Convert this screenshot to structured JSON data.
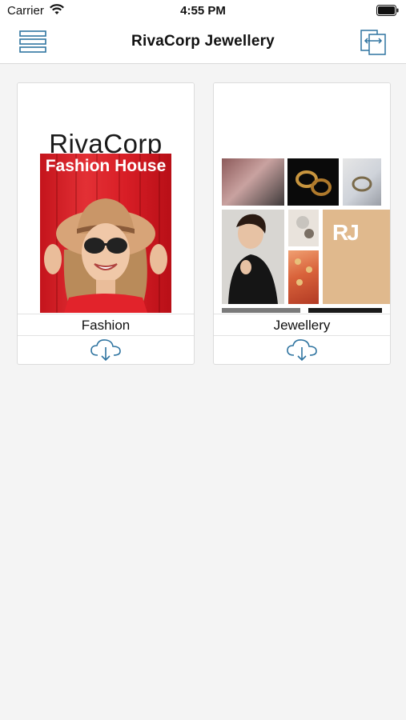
{
  "status_bar": {
    "carrier": "Carrier",
    "time": "4:55 PM"
  },
  "nav": {
    "title": "RivaCorp Jewellery",
    "menu_icon": "hamburger-icon",
    "switch_icon": "switch-screen-icon"
  },
  "catalogs": [
    {
      "label": "Fashion",
      "cover": {
        "brand": "RivaCorp",
        "title": "Fashion House"
      },
      "download_icon": "cloud-download-icon"
    },
    {
      "label": "Jewellery",
      "cover": {
        "logo": "RJ"
      },
      "download_icon": "cloud-download-icon"
    }
  ],
  "colors": {
    "accent": "#2f74a0",
    "cover_red": "#d81e26",
    "logo_tan": "#e0b98d"
  }
}
